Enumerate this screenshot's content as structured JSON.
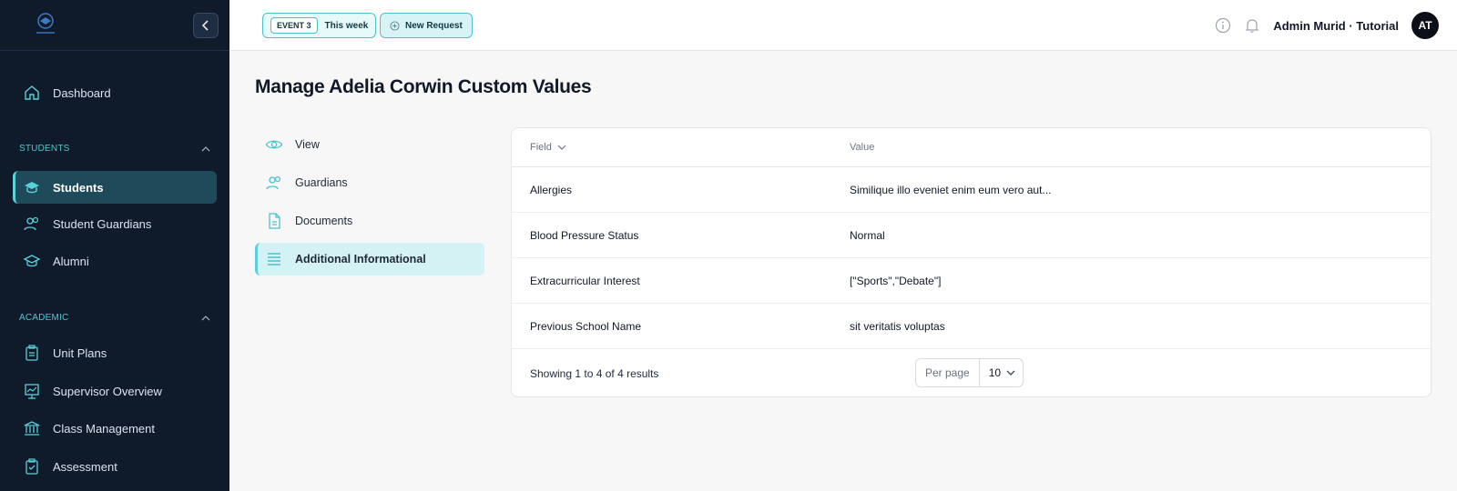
{
  "sidebar": {
    "logo_label": "logo",
    "main_items": [
      {
        "label": "Dashboard",
        "icon": "home-icon"
      }
    ],
    "sections": [
      {
        "title": "STUDENTS",
        "items": [
          {
            "label": "Students",
            "icon": "graduation-cap-icon",
            "active": true
          },
          {
            "label": "Student Guardians",
            "icon": "users-icon"
          },
          {
            "label": "Alumni",
            "icon": "mortarboard-icon"
          }
        ]
      },
      {
        "title": "ACADEMIC",
        "items": [
          {
            "label": "Unit Plans",
            "icon": "clipboard-icon"
          },
          {
            "label": "Supervisor Overview",
            "icon": "presentation-chart-icon"
          },
          {
            "label": "Class Management",
            "icon": "building-columns-icon"
          },
          {
            "label": "Assessment",
            "icon": "clipboard-check-icon"
          }
        ]
      }
    ]
  },
  "topbar": {
    "event_tag": "EVENT 3",
    "event_period": "This week",
    "new_request": "New Request",
    "user_name": "Admin Murid · Tutorial",
    "avatar_initials": "AT"
  },
  "page": {
    "title": "Manage Adelia Corwin Custom Values"
  },
  "subnav": [
    {
      "label": "View",
      "icon": "eye-icon"
    },
    {
      "label": "Guardians",
      "icon": "users-icon"
    },
    {
      "label": "Documents",
      "icon": "document-icon"
    },
    {
      "label": "Additional Informational",
      "icon": "list-icon",
      "active": true
    }
  ],
  "table": {
    "headers": {
      "field": "Field",
      "value": "Value"
    },
    "rows": [
      {
        "field": "Allergies",
        "value": "Similique illo eveniet enim eum vero aut..."
      },
      {
        "field": "Blood Pressure Status",
        "value": "Normal"
      },
      {
        "field": "Extracurricular Interest",
        "value": "[\"Sports\",\"Debate\"]"
      },
      {
        "field": "Previous School Name",
        "value": "sit veritatis voluptas"
      }
    ],
    "footer": {
      "showing": "Showing 1 to 4 of 4 results",
      "per_page_label": "Per page",
      "per_page_value": "10"
    }
  },
  "colors": {
    "sidebar_bg": "#0f1a2b",
    "accent": "#5ad1d9",
    "active_bg": "#1f4a5a"
  }
}
